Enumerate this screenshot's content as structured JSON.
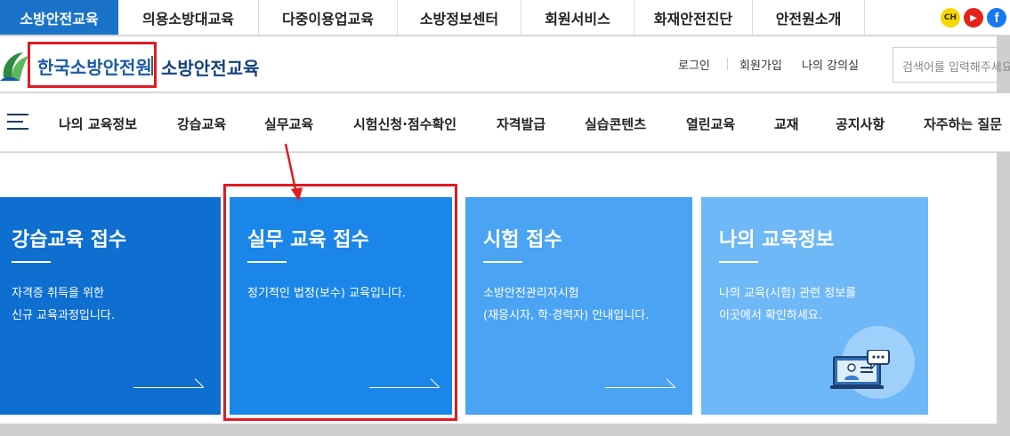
{
  "topbar": {
    "sites": [
      {
        "label": "소방안전교육",
        "active": true
      },
      {
        "label": "의용소방대교육",
        "active": false
      },
      {
        "label": "다중이용업교육",
        "active": false
      },
      {
        "label": "소방정보센터",
        "active": false
      },
      {
        "label": "회원서비스",
        "active": false
      },
      {
        "label": "화재안전진단",
        "active": false
      },
      {
        "label": "안전원소개",
        "active": false
      }
    ],
    "social": {
      "kakao": "CH",
      "youtube": "▶",
      "facebook": "f"
    }
  },
  "header": {
    "org_name": "한국소방안전원",
    "brand": "소방안전교육",
    "utility": [
      "로그인",
      "회원가입",
      "나의 강의실"
    ],
    "search_placeholder": "검색어를 입력해주세요"
  },
  "nav": {
    "items": [
      "나의 교육정보",
      "강습교육",
      "실무교육",
      "시험신청·점수확인",
      "자격발급",
      "실습콘텐츠",
      "열린교육",
      "교재",
      "공지사항",
      "자주하는 질문"
    ]
  },
  "cards": [
    {
      "title": "강습교육 접수",
      "desc": [
        "자격증 취득을 위한",
        "신규 교육과정입니다."
      ]
    },
    {
      "title": "실무 교육 접수",
      "desc": [
        "정기적인 법정(보수) 교육입니다."
      ]
    },
    {
      "title": "시험 접수",
      "desc": [
        "소방안전관리자시험",
        "(재응시자, 학·경력자) 안내입니다."
      ]
    },
    {
      "title": "나의 교육정보",
      "desc": [
        "나의 교육(시험) 관련 정보를",
        "이곳에서 확인하세요."
      ]
    }
  ],
  "colors": {
    "accent": "#1a73c8",
    "highlight": "#e11b22",
    "card1": "#0e6fd0",
    "card2": "#1b86ea",
    "card3": "#4aa3f3",
    "card4": "#6fb8f7"
  }
}
